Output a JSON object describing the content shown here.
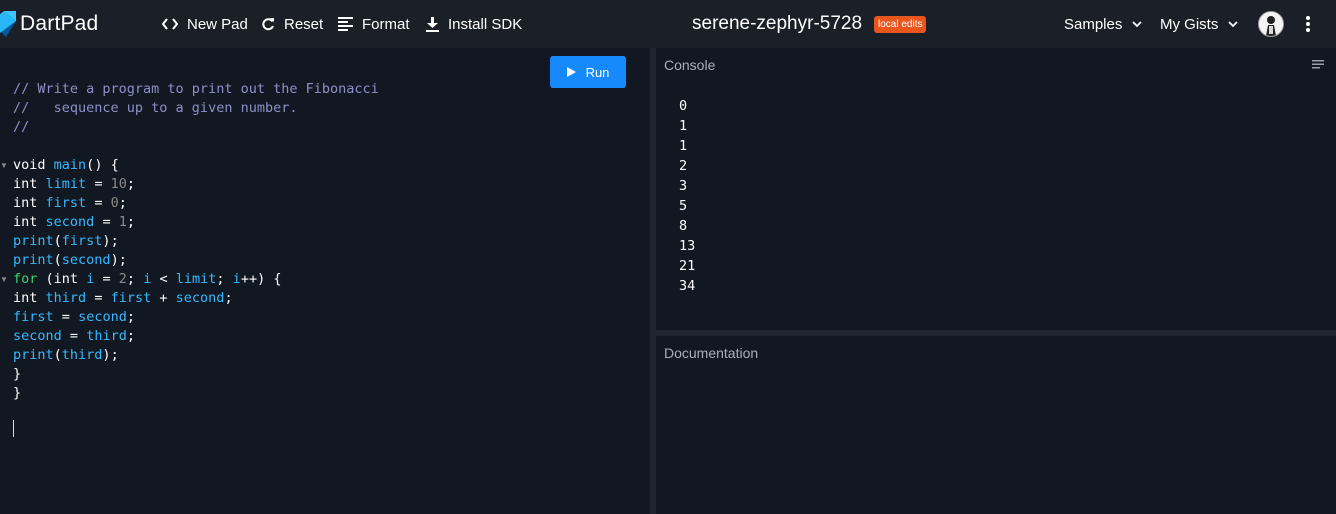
{
  "header": {
    "app_name": "DartPad",
    "new_pad": "New Pad",
    "reset": "Reset",
    "format": "Format",
    "install_sdk": "Install SDK",
    "pad_title": "serene-zephyr-5728",
    "badge": "local edits",
    "samples": "Samples",
    "my_gists": "My Gists"
  },
  "editor": {
    "run_label": "Run",
    "code_lines": [
      "// Write a program to print out the Fibonacci",
      "//   sequence up to a given number.",
      "//",
      "",
      "void main() {",
      "int limit = 10;",
      "int first = 0;",
      "int second = 1;",
      "print(first);",
      "print(second);",
      "for (int i = 2; i < limit; i++) {",
      "int third = first + second;",
      "first = second;",
      "second = third;",
      "print(third);",
      "}",
      "}"
    ]
  },
  "console": {
    "label": "Console",
    "output": [
      "0",
      "1",
      "1",
      "2",
      "3",
      "5",
      "8",
      "13",
      "21",
      "34"
    ]
  },
  "documentation": {
    "label": "Documentation"
  },
  "colors": {
    "accent": "#168afd",
    "badge": "#e8561f",
    "background": "#121821"
  }
}
